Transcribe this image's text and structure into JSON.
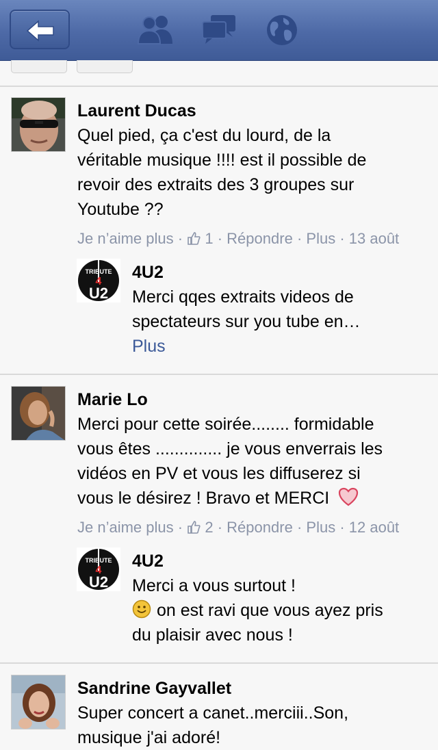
{
  "nav": {
    "back_label": "back",
    "icons": [
      "friends-icon",
      "messages-icon",
      "globe-icon"
    ]
  },
  "comments": [
    {
      "author": "Laurent Ducas",
      "lines": [
        "Quel pied, ça c'est du lourd, de la",
        "véritable musique !!!! est il possible de",
        "revoir des extraits des 3 groupes sur",
        "Youtube ??"
      ],
      "unlike": "Je n’aime plus",
      "likes": "1",
      "reply": "Répondre",
      "more": "Plus",
      "date": "13 août",
      "reply_item": {
        "author": "4U2",
        "lines": [
          "Merci qqes extraits videos de",
          "spectateurs sur you tube en…"
        ],
        "more_link": "Plus"
      }
    },
    {
      "author": "Marie Lo",
      "lines": [
        "Merci pour cette soirée........ formidable",
        "vous êtes .............. je vous enverrais les",
        "vidéos en PV et vous les diffuserez si",
        "vous le désirez ! Bravo et MERCI"
      ],
      "unlike": "Je n’aime plus",
      "likes": "2",
      "reply": "Répondre",
      "more": "Plus",
      "date": "12 août",
      "reply_item": {
        "author": "4U2",
        "lines": [
          "Merci a vous surtout !",
          "on est ravi que vous ayez pris",
          "du plaisir avec nous !"
        ]
      }
    },
    {
      "author": "Sandrine Gayvallet",
      "lines": [
        "Super concert a canet..merciii..Son,",
        "musique j'ai adoré!"
      ]
    }
  ],
  "logo": {
    "top": "TRIBUTE",
    "mid": "4",
    "bottom": "U2"
  },
  "colors": {
    "bar": "#4d69a6",
    "link": "#3b5998",
    "meta": "#8b94a8",
    "heart": "#d9455f",
    "smiley": "#f3c43a"
  }
}
